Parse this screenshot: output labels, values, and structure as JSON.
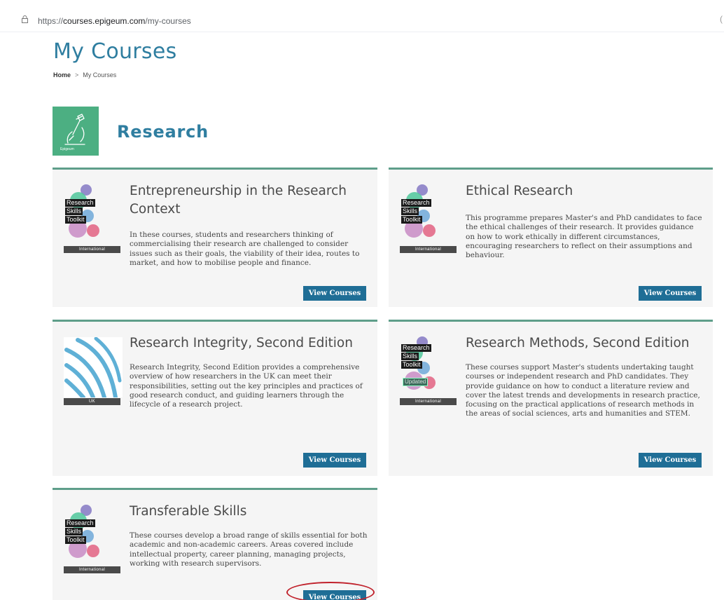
{
  "browser": {
    "url_scheme": "https://",
    "url_host": "courses.epigeum.com",
    "url_path": "/my-courses"
  },
  "page": {
    "title": "My Courses",
    "breadcrumb": {
      "home": "Home",
      "separator": ">",
      "current": "My Courses"
    }
  },
  "section": {
    "title": "Research",
    "icon": "research-microscope-icon",
    "icon_color": "#4caf82"
  },
  "colors": {
    "accent": "#2f7ea0",
    "button": "#1f6e96",
    "card_border": "#5e9e8a",
    "highlight": "#c0212b"
  },
  "logo_text": {
    "line1": "Research",
    "line2": "Skills",
    "line3": "Toolkit",
    "updated": "Updated"
  },
  "courses": [
    {
      "title": "Entrepreneurship in the Research Context",
      "description": "In these courses, students and researchers thinking of commercialising their research are challenged to consider issues such as their goals, the viability of their idea, routes to market, and how to mobilise people and finance.",
      "region": "International",
      "button": "View Courses",
      "logo": "research-skills-toolkit-logo"
    },
    {
      "title": "Ethical Research",
      "description": "This programme prepares Master's and PhD candidates to face the ethical challenges of their research. It provides guidance on how to work ethically in different circumstances, encouraging researchers to reflect on their assumptions and behaviour.",
      "region": "International",
      "button": "View Courses",
      "logo": "research-skills-toolkit-logo"
    },
    {
      "title": "Research Integrity, Second Edition",
      "description": "Research Integrity, Second Edition provides a comprehensive overview of how researchers in the UK can meet their responsibilities, setting out the key principles and practices of good research conduct, and guiding learners through the lifecycle of a research project.",
      "region": "UK",
      "button": "View Courses",
      "logo": "research-integrity-logo"
    },
    {
      "title": "Research Methods, Second Edition",
      "description": "These courses support Master's students undertaking taught courses or independent research and PhD candidates. They provide guidance on how to conduct a literature review and cover the latest trends and developments in research practice, focusing on the practical applications of research methods in the areas of social sciences, arts and humanities and STEM.",
      "region": "International",
      "button": "View Courses",
      "logo": "research-skills-toolkit-updated-logo"
    },
    {
      "title": "Transferable Skills",
      "description": "These courses develop a broad range of skills essential for both academic and non-academic careers. Areas covered include intellectual property, career planning, managing projects, working with research supervisors.",
      "region": "International",
      "button": "View Courses",
      "logo": "research-skills-toolkit-logo"
    }
  ]
}
